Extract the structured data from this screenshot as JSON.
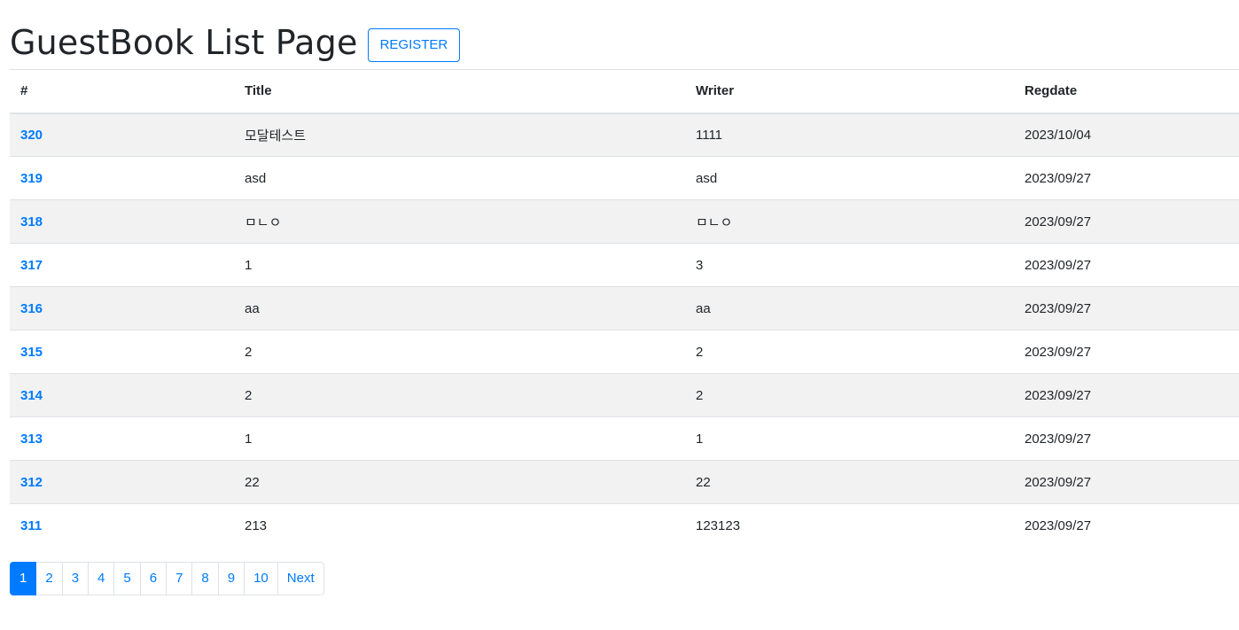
{
  "header": {
    "title": "GuestBook List Page",
    "register_label": "REGISTER"
  },
  "table": {
    "columns": [
      "#",
      "Title",
      "Writer",
      "Regdate"
    ],
    "rows": [
      {
        "gno": "320",
        "title": "모달테스트",
        "writer": "1111",
        "regdate": "2023/10/04"
      },
      {
        "gno": "319",
        "title": "asd",
        "writer": "asd",
        "regdate": "2023/09/27"
      },
      {
        "gno": "318",
        "title": "ㅁㄴㅇ",
        "writer": "ㅁㄴㅇ",
        "regdate": "2023/09/27"
      },
      {
        "gno": "317",
        "title": "1",
        "writer": "3",
        "regdate": "2023/09/27"
      },
      {
        "gno": "316",
        "title": "aa",
        "writer": "aa",
        "regdate": "2023/09/27"
      },
      {
        "gno": "315",
        "title": "2",
        "writer": "2",
        "regdate": "2023/09/27"
      },
      {
        "gno": "314",
        "title": "2",
        "writer": "2",
        "regdate": "2023/09/27"
      },
      {
        "gno": "313",
        "title": "1",
        "writer": "1",
        "regdate": "2023/09/27"
      },
      {
        "gno": "312",
        "title": "22",
        "writer": "22",
        "regdate": "2023/09/27"
      },
      {
        "gno": "311",
        "title": "213",
        "writer": "123123",
        "regdate": "2023/09/27"
      }
    ]
  },
  "pagination": {
    "pages": [
      "1",
      "2",
      "3",
      "4",
      "5",
      "6",
      "7",
      "8",
      "9",
      "10"
    ],
    "active_page": "1",
    "next_label": "Next"
  },
  "colors": {
    "accent": "#007bff",
    "stripe": "#f2f2f2",
    "text": "#212529",
    "border": "#dee2e6"
  }
}
